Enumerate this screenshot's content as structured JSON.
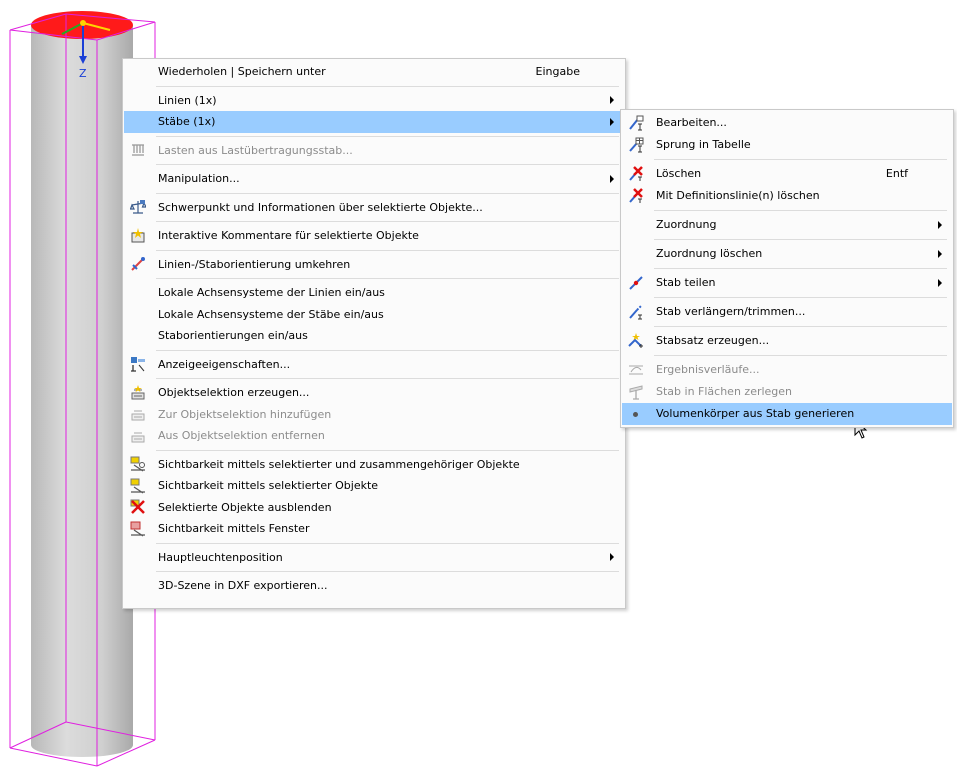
{
  "viewport": {
    "axis_label": "Z"
  },
  "context_menu": {
    "items": [
      {
        "label": "Wiederholen | Speichern unter",
        "shortcut": "Eingabe"
      },
      {
        "label": "Linien (1x)"
      },
      {
        "label": "Stäbe (1x)"
      },
      {
        "label": "Lasten aus Lastübertragungsstab..."
      },
      {
        "label": "Manipulation..."
      },
      {
        "label": "Schwerpunkt und Informationen über selektierte Objekte..."
      },
      {
        "label": "Interaktive Kommentare für selektierte Objekte"
      },
      {
        "label": "Linien-/Staborientierung umkehren"
      },
      {
        "label": "Lokale Achsensysteme der Linien ein/aus"
      },
      {
        "label": "Lokale Achsensysteme der Stäbe ein/aus"
      },
      {
        "label": "Staborientierungen ein/aus"
      },
      {
        "label": "Anzeigeeigenschaften..."
      },
      {
        "label": "Objektselektion erzeugen..."
      },
      {
        "label": "Zur Objektselektion hinzufügen"
      },
      {
        "label": "Aus Objektselektion entfernen"
      },
      {
        "label": "Sichtbarkeit mittels selektierter und zusammengehöriger Objekte"
      },
      {
        "label": "Sichtbarkeit mittels selektierter Objekte"
      },
      {
        "label": "Selektierte Objekte ausblenden"
      },
      {
        "label": "Sichtbarkeit mittels Fenster"
      },
      {
        "label": "Hauptleuchtenposition"
      },
      {
        "label": "3D-Szene in DXF exportieren..."
      }
    ]
  },
  "submenu": {
    "items": [
      {
        "label": "Bearbeiten..."
      },
      {
        "label": "Sprung in Tabelle"
      },
      {
        "label": "Löschen",
        "shortcut": "Entf"
      },
      {
        "label": "Mit Definitionslinie(n) löschen"
      },
      {
        "label": "Zuordnung"
      },
      {
        "label": "Zuordnung löschen"
      },
      {
        "label": "Stab teilen"
      },
      {
        "label": "Stab verlängern/trimmen..."
      },
      {
        "label": "Stabsatz erzeugen..."
      },
      {
        "label": "Ergebnisverläufe..."
      },
      {
        "label": "Stab in Flächen zerlegen"
      },
      {
        "label": "Volumenkörper aus Stab generieren"
      }
    ]
  },
  "colors": {
    "highlight": "#99ccff",
    "wireframe": "#e020e0",
    "cap": "#ff1a1a",
    "disabled_text": "#8c8c8c"
  }
}
